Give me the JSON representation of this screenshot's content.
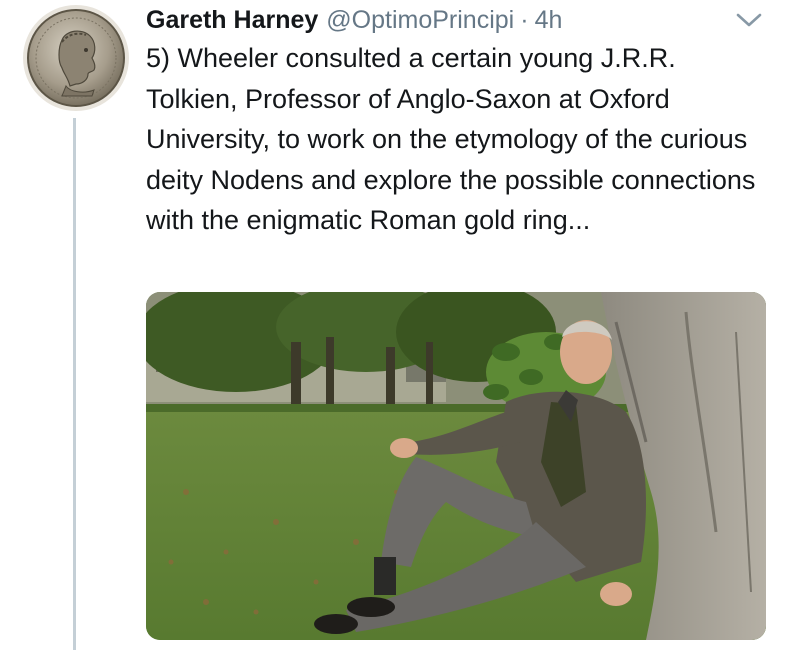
{
  "tweet": {
    "author_name": "Gareth Harney",
    "author_handle": "@OptimoPrincipi",
    "separator": "·",
    "timestamp": "4h",
    "text": "5) Wheeler consulted a certain young J.R.R. Tolkien, Professor of Anglo-Saxon at Oxford University, to work on the etymology of the curious deity Nodens and explore the possible connections with the enigmatic Roman gold ring...",
    "avatar_icon": "roman-coin-avatar",
    "menu_icon": "chevron-down-icon"
  },
  "colors": {
    "name_text": "#14171a",
    "secondary_text": "#657786",
    "thread_line": "#c4cfd6"
  }
}
